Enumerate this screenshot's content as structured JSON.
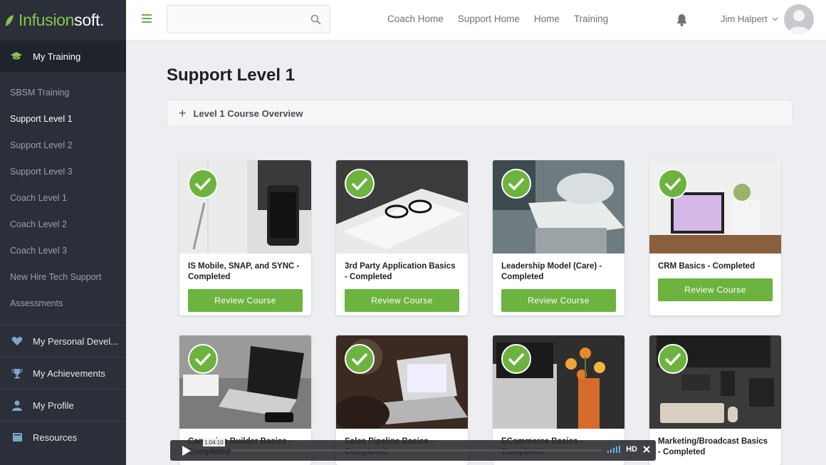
{
  "app": {
    "logo_prefix": "Infusion",
    "logo_suffix": "soft."
  },
  "sidebar": {
    "main_item": "My Training",
    "sub_items": [
      {
        "label": "SBSM Training"
      },
      {
        "label": "Support Level 1"
      },
      {
        "label": "Support Level 2"
      },
      {
        "label": "Support Level 3"
      },
      {
        "label": "Coach Level 1"
      },
      {
        "label": "Coach Level 2"
      },
      {
        "label": "Coach Level 3"
      },
      {
        "label": "New Hire Tech Support"
      },
      {
        "label": "Assessments"
      }
    ],
    "sections": [
      {
        "label": "My Personal Devel..."
      },
      {
        "label": "My Achievements"
      },
      {
        "label": "My Profile"
      },
      {
        "label": "Resources"
      }
    ]
  },
  "topbar": {
    "nav": [
      "Coach Home",
      "Support Home",
      "Home",
      "Training"
    ],
    "user_name": "Jim Halpert"
  },
  "main": {
    "title": "Support Level 1",
    "accordion_label": "Level 1 Course Overview",
    "button_label": "Review Course",
    "cards": [
      {
        "title": "IS Mobile, SNAP, and SYNC - Completed"
      },
      {
        "title": "3rd Party Application Basics - Completed"
      },
      {
        "title": "Leadership Model (Care) - Completed"
      },
      {
        "title": "CRM Basics - Completed"
      },
      {
        "title": "Campaign Builder Basics - Completed"
      },
      {
        "title": "Sales Pipeline Basics - Completed"
      },
      {
        "title": "ECommerce Basics - Completed"
      },
      {
        "title": "Marketing/Broadcast Basics - Completed"
      }
    ]
  },
  "video": {
    "time": "1:04:10",
    "quality": "HD"
  },
  "colors": {
    "accent": "#6cb33f",
    "sidebar": "#2a2f3a"
  }
}
